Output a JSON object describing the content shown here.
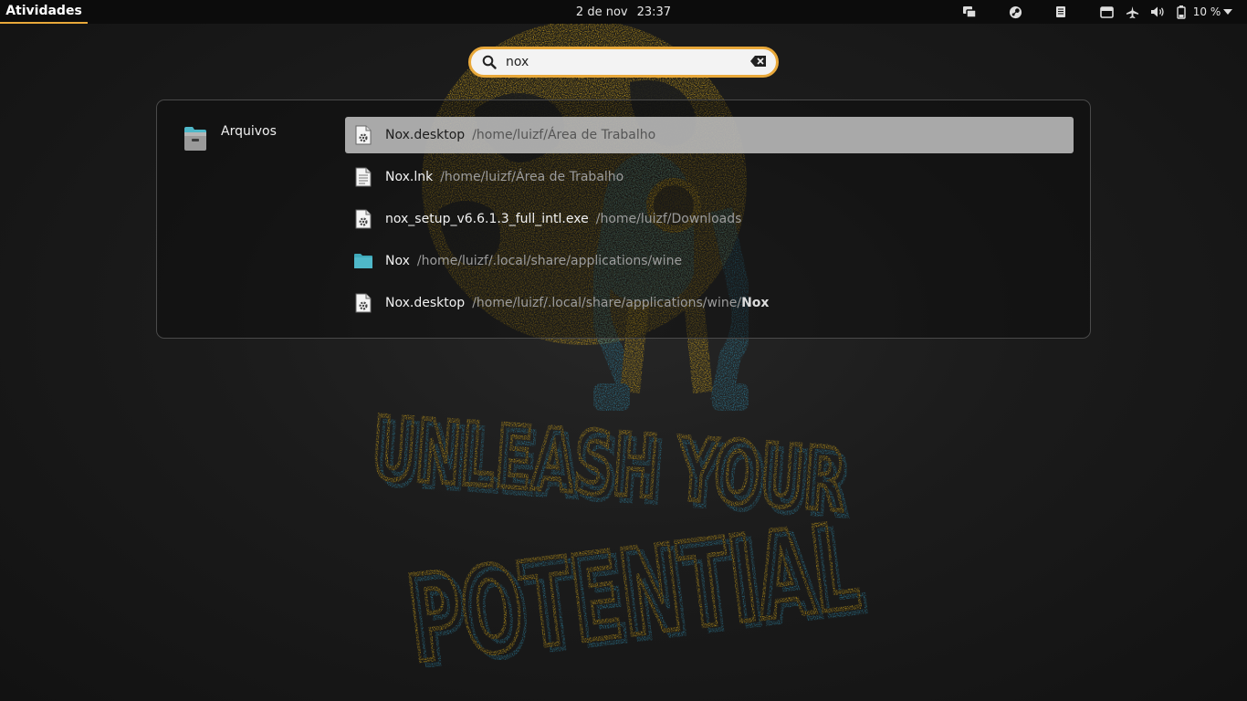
{
  "topbar": {
    "activities": "Atividades",
    "date": "2 de nov",
    "time": "23:37",
    "battery_percent": "10 %"
  },
  "search": {
    "value": "nox",
    "placeholder": ""
  },
  "results": {
    "provider_name": "Arquivos",
    "items": [
      {
        "name": "Nox.desktop",
        "path": "/home/luizf/Área de Trabalho",
        "path_bold": "",
        "icon": "settings-file-icon",
        "selected": true
      },
      {
        "name": "Nox.lnk",
        "path": "/home/luizf/Área de Trabalho",
        "path_bold": "",
        "icon": "text-file-icon",
        "selected": false
      },
      {
        "name": "nox_setup_v6.6.1.3_full_intl.exe",
        "path": "/home/luizf/Downloads",
        "path_bold": "",
        "icon": "settings-file-icon",
        "selected": false
      },
      {
        "name": "Nox",
        "path": "/home/luizf/.local/share/applications/wine",
        "path_bold": "",
        "icon": "folder-icon",
        "selected": false
      },
      {
        "name": "Nox.desktop",
        "path": "/home/luizf/.local/share/applications/wine/",
        "path_bold": "Nox",
        "icon": "settings-file-icon",
        "selected": false
      }
    ]
  },
  "wallpaper": {
    "line1": "UNLEASH YOUR",
    "line2": "POTENTIAL"
  },
  "colors": {
    "accent": "#e8a83a",
    "wallpaper_yellow": "#c59b1a",
    "wallpaper_blue": "#2c7c98",
    "folder_teal": "#4fb8c9"
  }
}
